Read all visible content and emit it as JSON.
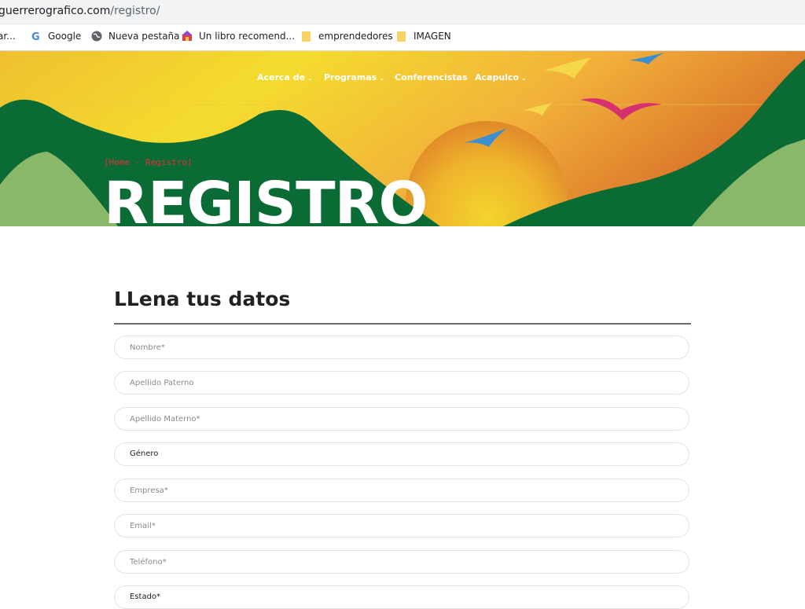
{
  "browser": {
    "url_domain": "guerrerografico.com",
    "url_path": "/registro/",
    "bookmarks": [
      {
        "label": "ar...",
        "icon": "none"
      },
      {
        "label": "Google",
        "icon": "google-icon"
      },
      {
        "label": "Nueva pestaña",
        "icon": "globe-icon"
      },
      {
        "label": "Un libro recomend...",
        "icon": "site-icon"
      },
      {
        "label": "emprendedores",
        "icon": "folder-icon"
      },
      {
        "label": "IMAGEN",
        "icon": "folder-icon"
      }
    ]
  },
  "nav": {
    "items": [
      {
        "label": "Acerca de",
        "has_dropdown": true
      },
      {
        "label": "Programas",
        "has_dropdown": true
      },
      {
        "label": "Conferencistas",
        "has_dropdown": false
      },
      {
        "label": "Acapulco",
        "has_dropdown": true
      }
    ]
  },
  "hero": {
    "breadcrumb": "[Home - Registro]",
    "title": "REGISTRO",
    "colors": {
      "sky": "#f2d12a",
      "orange": "#e08a2a",
      "hill": "#0a6b35",
      "light_hill": "#8ab86a",
      "sun": "#e8a82a"
    }
  },
  "form": {
    "title": "LLena tus datos",
    "fields": [
      {
        "placeholder": "Nombre*",
        "value": ""
      },
      {
        "placeholder": "Apellido Paterno",
        "value": ""
      },
      {
        "placeholder": "Apellido Materno*",
        "value": ""
      },
      {
        "type": "select",
        "selected": "Género"
      },
      {
        "placeholder": "Empresa*",
        "value": ""
      },
      {
        "placeholder": "Email*",
        "value": ""
      },
      {
        "placeholder": "Teléfono*",
        "value": ""
      },
      {
        "type": "select",
        "selected": "Estado*"
      }
    ]
  }
}
